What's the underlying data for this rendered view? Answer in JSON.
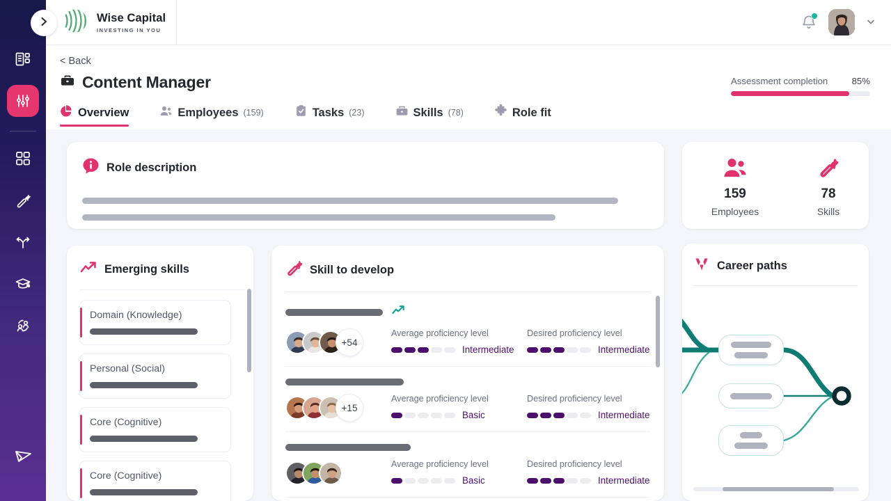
{
  "sidebar": {
    "expand_button": "expand-sidebar",
    "items": [
      {
        "icon": "list-document-icon",
        "name": "reports",
        "active": false
      },
      {
        "icon": "sliders-icon",
        "name": "settings-panel",
        "active": true
      },
      {
        "icon": "grid-apps-icon",
        "name": "apps",
        "active": false
      },
      {
        "icon": "wrench-icon",
        "name": "skills",
        "active": false
      },
      {
        "icon": "branch-paths-icon",
        "name": "career-paths",
        "active": false
      },
      {
        "icon": "graduation-cap-icon",
        "name": "learning",
        "active": false
      },
      {
        "icon": "people-network-icon",
        "name": "people",
        "active": false
      },
      {
        "icon": "paper-plane-icon",
        "name": "send",
        "active": false
      }
    ]
  },
  "brand": {
    "name": "Wise Capital",
    "tagline": "INVESTING IN YOU",
    "logo_icon": "woven-sphere-logo",
    "logo_color": "#4ea96f"
  },
  "topbar": {
    "notifications_icon": "bell-icon",
    "has_notification": true,
    "notification_dot_color": "#16b6a5",
    "avatar": "user-avatar",
    "chevron": "˅"
  },
  "header": {
    "back_label": "< Back",
    "title": "Content Manager",
    "title_icon": "briefcase-icon",
    "assessment": {
      "label": "Assessment completion",
      "percent_text": "85%",
      "percent_value": 85,
      "bar_color": "#e0336e"
    }
  },
  "tabs": [
    {
      "label": "Overview",
      "count": "",
      "icon": "pie-chart-icon",
      "active": true
    },
    {
      "label": "Employees",
      "count": "(159)",
      "icon": "people-icon",
      "active": false
    },
    {
      "label": "Tasks",
      "count": "(23)",
      "icon": "clipboard-check-icon",
      "active": false
    },
    {
      "label": "Skills",
      "count": "(78)",
      "icon": "briefcase-icon",
      "active": false
    },
    {
      "label": "Role fit",
      "count": "",
      "icon": "puzzle-piece-icon",
      "active": false
    }
  ],
  "role_description": {
    "title": "Role description",
    "icon": "info-bubble-icon"
  },
  "stats": [
    {
      "value": "159",
      "label": "Employees",
      "icon": "people-icon"
    },
    {
      "value": "78",
      "label": "Skills",
      "icon": "wrench-icon"
    }
  ],
  "emerging_skills": {
    "title": "Emerging skills",
    "icon": "trending-up-icon",
    "items": [
      {
        "name": "Domain (Knowledge)"
      },
      {
        "name": "Personal (Social)"
      },
      {
        "name": "Core (Cognitive)"
      },
      {
        "name": "Core (Cognitive)"
      }
    ]
  },
  "skill_to_develop": {
    "title": "Skill to develop",
    "icon": "wrench-icon",
    "average_label": "Average proficiency level",
    "desired_label": "Desired proficiency level",
    "rows": [
      {
        "trending": true,
        "more_count": "+54",
        "average_level": "Intermediate",
        "average_filled": 3,
        "desired_level": "Intermediate",
        "desired_filled": 3
      },
      {
        "trending": false,
        "more_count": "+15",
        "average_level": "Basic",
        "average_filled": 1,
        "desired_level": "Intermediate",
        "desired_filled": 3
      },
      {
        "trending": false,
        "more_count": "",
        "average_level": "Basic",
        "average_filled": 1,
        "desired_level": "Intermediate",
        "desired_filled": 3
      }
    ],
    "segment_total": 5
  },
  "career_paths": {
    "title": "Career paths",
    "icon": "career-branch-icon",
    "line_color": "#0e7c72"
  },
  "colors": {
    "accent_pink": "#e0336e",
    "purple": "#4c0f6b",
    "teal": "#0e7c72",
    "page_bg": "#f4f5fa"
  }
}
